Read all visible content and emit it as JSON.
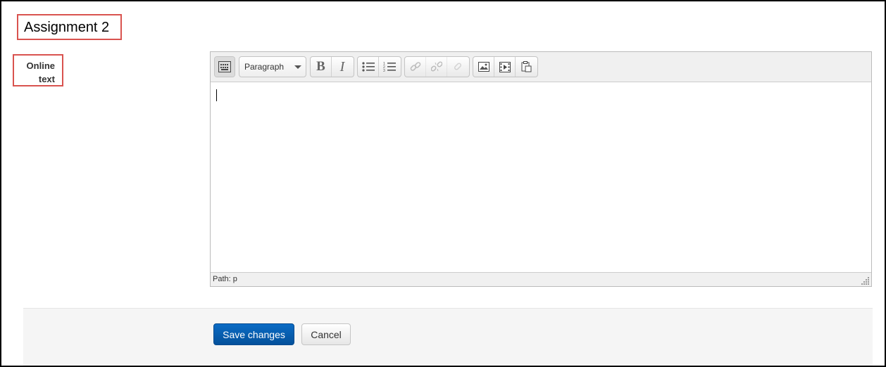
{
  "page": {
    "heading": "Assignment 2",
    "field_label": "Online text"
  },
  "editor": {
    "toolbar": {
      "format_select": "Paragraph",
      "buttons": [
        {
          "name": "toggle-toolbar-icon"
        },
        {
          "name": "bold-icon",
          "glyph": "B"
        },
        {
          "name": "italic-icon",
          "glyph": "I"
        },
        {
          "name": "unordered-list-icon"
        },
        {
          "name": "ordered-list-icon"
        },
        {
          "name": "link-icon"
        },
        {
          "name": "unlink-icon"
        },
        {
          "name": "anchor-icon"
        },
        {
          "name": "image-icon"
        },
        {
          "name": "media-icon"
        },
        {
          "name": "paste-icon"
        }
      ]
    },
    "content": "",
    "status_path": "Path: p"
  },
  "form": {
    "save_label": "Save changes",
    "cancel_label": "Cancel"
  },
  "colors": {
    "highlight_border": "#d9534f",
    "primary_button": "#0a5fb4"
  }
}
